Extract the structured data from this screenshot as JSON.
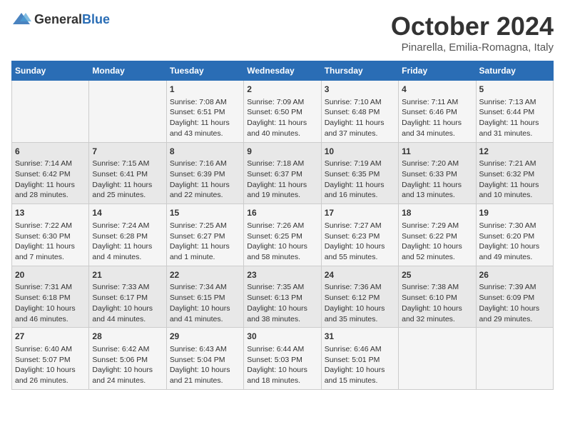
{
  "header": {
    "logo_general": "General",
    "logo_blue": "Blue",
    "month": "October 2024",
    "location": "Pinarella, Emilia-Romagna, Italy"
  },
  "days_of_week": [
    "Sunday",
    "Monday",
    "Tuesday",
    "Wednesday",
    "Thursday",
    "Friday",
    "Saturday"
  ],
  "weeks": [
    [
      {
        "day": "",
        "content": ""
      },
      {
        "day": "",
        "content": ""
      },
      {
        "day": "1",
        "content": "Sunrise: 7:08 AM\nSunset: 6:51 PM\nDaylight: 11 hours and 43 minutes."
      },
      {
        "day": "2",
        "content": "Sunrise: 7:09 AM\nSunset: 6:50 PM\nDaylight: 11 hours and 40 minutes."
      },
      {
        "day": "3",
        "content": "Sunrise: 7:10 AM\nSunset: 6:48 PM\nDaylight: 11 hours and 37 minutes."
      },
      {
        "day": "4",
        "content": "Sunrise: 7:11 AM\nSunset: 6:46 PM\nDaylight: 11 hours and 34 minutes."
      },
      {
        "day": "5",
        "content": "Sunrise: 7:13 AM\nSunset: 6:44 PM\nDaylight: 11 hours and 31 minutes."
      }
    ],
    [
      {
        "day": "6",
        "content": "Sunrise: 7:14 AM\nSunset: 6:42 PM\nDaylight: 11 hours and 28 minutes."
      },
      {
        "day": "7",
        "content": "Sunrise: 7:15 AM\nSunset: 6:41 PM\nDaylight: 11 hours and 25 minutes."
      },
      {
        "day": "8",
        "content": "Sunrise: 7:16 AM\nSunset: 6:39 PM\nDaylight: 11 hours and 22 minutes."
      },
      {
        "day": "9",
        "content": "Sunrise: 7:18 AM\nSunset: 6:37 PM\nDaylight: 11 hours and 19 minutes."
      },
      {
        "day": "10",
        "content": "Sunrise: 7:19 AM\nSunset: 6:35 PM\nDaylight: 11 hours and 16 minutes."
      },
      {
        "day": "11",
        "content": "Sunrise: 7:20 AM\nSunset: 6:33 PM\nDaylight: 11 hours and 13 minutes."
      },
      {
        "day": "12",
        "content": "Sunrise: 7:21 AM\nSunset: 6:32 PM\nDaylight: 11 hours and 10 minutes."
      }
    ],
    [
      {
        "day": "13",
        "content": "Sunrise: 7:22 AM\nSunset: 6:30 PM\nDaylight: 11 hours and 7 minutes."
      },
      {
        "day": "14",
        "content": "Sunrise: 7:24 AM\nSunset: 6:28 PM\nDaylight: 11 hours and 4 minutes."
      },
      {
        "day": "15",
        "content": "Sunrise: 7:25 AM\nSunset: 6:27 PM\nDaylight: 11 hours and 1 minute."
      },
      {
        "day": "16",
        "content": "Sunrise: 7:26 AM\nSunset: 6:25 PM\nDaylight: 10 hours and 58 minutes."
      },
      {
        "day": "17",
        "content": "Sunrise: 7:27 AM\nSunset: 6:23 PM\nDaylight: 10 hours and 55 minutes."
      },
      {
        "day": "18",
        "content": "Sunrise: 7:29 AM\nSunset: 6:22 PM\nDaylight: 10 hours and 52 minutes."
      },
      {
        "day": "19",
        "content": "Sunrise: 7:30 AM\nSunset: 6:20 PM\nDaylight: 10 hours and 49 minutes."
      }
    ],
    [
      {
        "day": "20",
        "content": "Sunrise: 7:31 AM\nSunset: 6:18 PM\nDaylight: 10 hours and 46 minutes."
      },
      {
        "day": "21",
        "content": "Sunrise: 7:33 AM\nSunset: 6:17 PM\nDaylight: 10 hours and 44 minutes."
      },
      {
        "day": "22",
        "content": "Sunrise: 7:34 AM\nSunset: 6:15 PM\nDaylight: 10 hours and 41 minutes."
      },
      {
        "day": "23",
        "content": "Sunrise: 7:35 AM\nSunset: 6:13 PM\nDaylight: 10 hours and 38 minutes."
      },
      {
        "day": "24",
        "content": "Sunrise: 7:36 AM\nSunset: 6:12 PM\nDaylight: 10 hours and 35 minutes."
      },
      {
        "day": "25",
        "content": "Sunrise: 7:38 AM\nSunset: 6:10 PM\nDaylight: 10 hours and 32 minutes."
      },
      {
        "day": "26",
        "content": "Sunrise: 7:39 AM\nSunset: 6:09 PM\nDaylight: 10 hours and 29 minutes."
      }
    ],
    [
      {
        "day": "27",
        "content": "Sunrise: 6:40 AM\nSunset: 5:07 PM\nDaylight: 10 hours and 26 minutes."
      },
      {
        "day": "28",
        "content": "Sunrise: 6:42 AM\nSunset: 5:06 PM\nDaylight: 10 hours and 24 minutes."
      },
      {
        "day": "29",
        "content": "Sunrise: 6:43 AM\nSunset: 5:04 PM\nDaylight: 10 hours and 21 minutes."
      },
      {
        "day": "30",
        "content": "Sunrise: 6:44 AM\nSunset: 5:03 PM\nDaylight: 10 hours and 18 minutes."
      },
      {
        "day": "31",
        "content": "Sunrise: 6:46 AM\nSunset: 5:01 PM\nDaylight: 10 hours and 15 minutes."
      },
      {
        "day": "",
        "content": ""
      },
      {
        "day": "",
        "content": ""
      }
    ]
  ]
}
